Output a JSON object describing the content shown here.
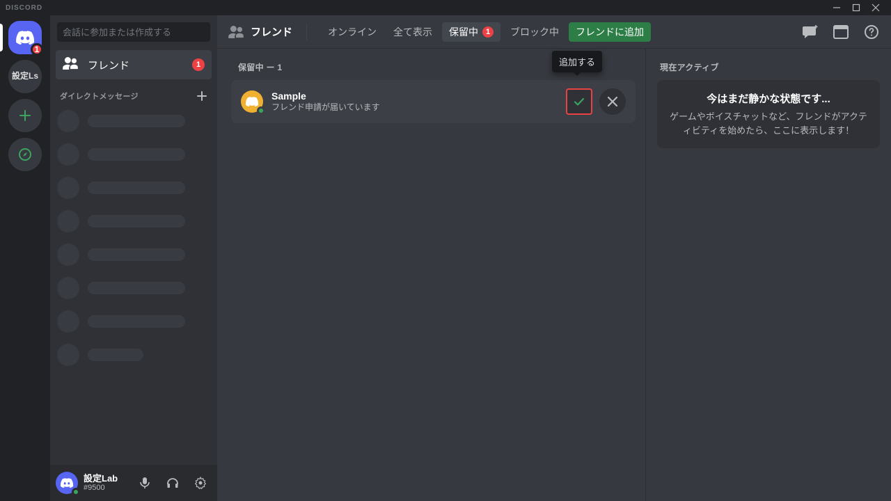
{
  "titlebar": {
    "logo": "DISCORD"
  },
  "guilds": {
    "home_badge": "1",
    "server_label": "設定Ls"
  },
  "sidebar": {
    "search_placeholder": "会話に参加または作成する",
    "friends_label": "フレンド",
    "friends_badge": "1",
    "dm_header": "ダイレクトメッセージ",
    "skeleton_widths": [
      140,
      140,
      140,
      140,
      140,
      140,
      140,
      80
    ]
  },
  "panel": {
    "username": "設定Lab",
    "tag": "#9500"
  },
  "header": {
    "title": "フレンド",
    "tabs": {
      "online": "オンライン",
      "all": "全て表示",
      "pending": "保留中",
      "pending_badge": "1",
      "blocked": "ブロック中",
      "add_friend": "フレンドに追加"
    }
  },
  "pending": {
    "header": "保留中 ー 1",
    "request": {
      "name": "Sample",
      "subtitle": "フレンド申請が届いています",
      "tooltip": "追加する"
    }
  },
  "now_playing": {
    "title": "現在アクティブ",
    "card_title": "今はまだ静かな状態です...",
    "card_body": "ゲームやボイスチャットなど、フレンドがアクティビティを始めたら、ここに表示します！"
  }
}
